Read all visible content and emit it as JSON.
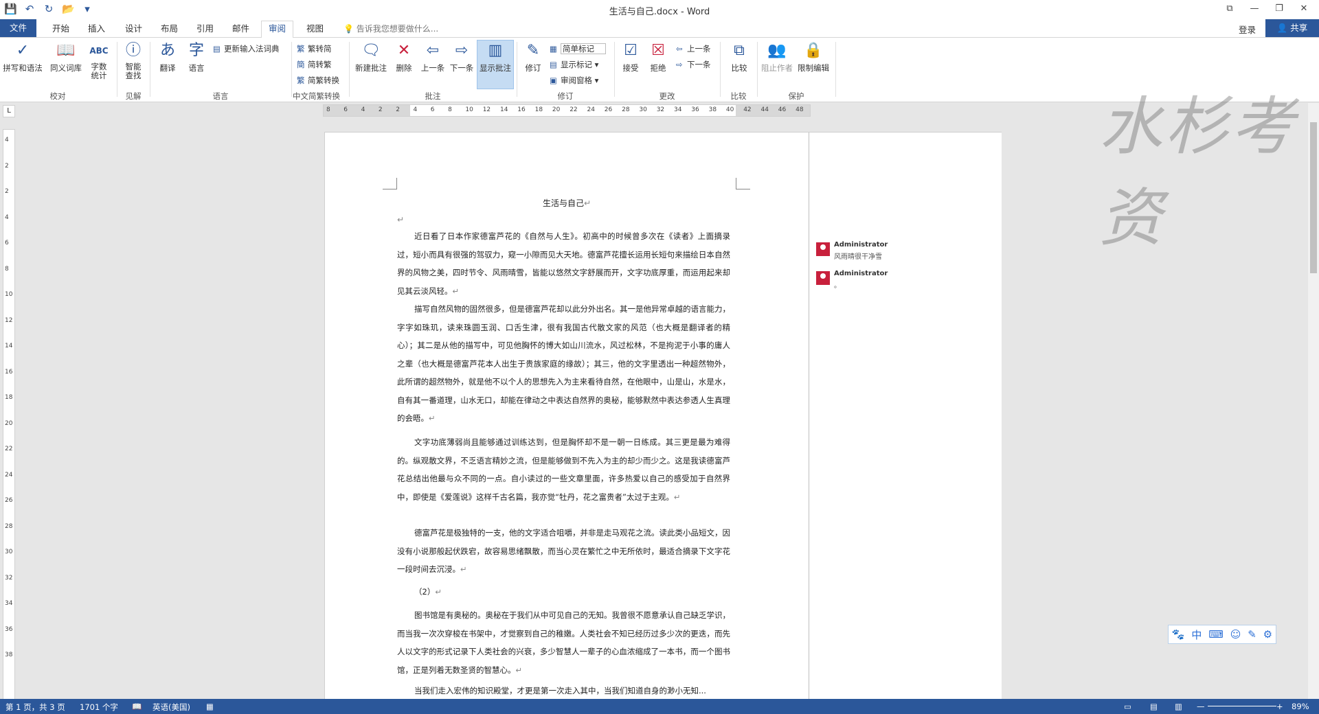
{
  "window": {
    "title": "生活与自己.docx - Word"
  },
  "qat": {
    "save_icon": "💾",
    "undo_icon": "↶",
    "redo_icon": "↻",
    "open_icon": "📂",
    "more_icon": "▾"
  },
  "tabs": {
    "file": "文件",
    "items": [
      "开始",
      "插入",
      "设计",
      "布局",
      "引用",
      "邮件",
      "审阅",
      "视图"
    ],
    "tell_me": "告诉我您想要做什么...",
    "login": "登录",
    "share": "共享"
  },
  "ribbon": {
    "spell": "拼写和语法",
    "thesaurus": "同义词库",
    "wordcount": "字数\n统计",
    "smart": "智能\n查找",
    "translate": "翻译",
    "language": "语言",
    "update_ime": "更新输入法词典",
    "t2s": "繁转简",
    "s2t": "简转繁",
    "convert": "简繁转换",
    "new_comment": "新建批注",
    "delete": "删除",
    "prev": "上一条",
    "next": "下一条",
    "show_comments": "显示批注",
    "track": "修订",
    "simple_markup": "简单标记",
    "show_markup": "显示标记",
    "review_pane": "审阅窗格",
    "accept": "接受",
    "reject": "拒绝",
    "prev2": "上一条",
    "next2": "下一条",
    "compare": "比较",
    "block_authors": "阻止作者",
    "restrict": "限制编辑",
    "groups": {
      "proofing": "校对",
      "insights": "见解",
      "language": "语言",
      "chinese": "中文简繁转换",
      "comments": "批注",
      "tracking": "修订",
      "changes": "更改",
      "compare": "比较",
      "protect": "保护"
    }
  },
  "ruler": {
    "h": [
      "8",
      "6",
      "4",
      "2",
      "2",
      "4",
      "6",
      "8",
      "10",
      "12",
      "14",
      "16",
      "18",
      "20",
      "22",
      "24",
      "26",
      "28",
      "30",
      "32",
      "34",
      "36",
      "38",
      "40",
      "42",
      "44",
      "46",
      "48"
    ],
    "v": [
      "4",
      "2",
      "2",
      "4",
      "6",
      "8",
      "10",
      "12",
      "14",
      "16",
      "18",
      "20",
      "22",
      "24",
      "26",
      "28",
      "30",
      "32",
      "34",
      "36",
      "38"
    ]
  },
  "document": {
    "title": "生活与自己",
    "paras": [
      "近日看了日本作家德富芦花的《自然与人生》。初高中的时候曾多次在《读者》上面摘录过，短小而具有很强的驾驭力，窥一小隙而见大天地。德富芦花擅长运用长短句来描绘日本自然界的风物之美，四时节令、风雨晴雪，皆能以悠然文字舒展而开，文字功底厚重，而运用起来却见其云淡风轻。",
      "描写自然风物的固然很多，但是德富芦花却以此分外出名。其一是他异常卓越的语言能力，字字如珠玑，读来珠圆玉润、口舌生津，很有我国古代散文家的风范（也大概是翻译者的精心）；其二是从他的描写中，可见他胸怀的博大如山川流水，风过松林，不是拘泥于小事的庸人之辈（也大概是德富芦花本人出生于贵族家庭的缘故）；其三，他的文字里透出一种超然物外，此所谓的超然物外，就是他不以个人的思想先入为主来看待自然，在他眼中，山是山，水是水，自有其一番道理，山水无口，却能在律动之中表达自然界的奥秘，能够默然中表达参透人生真理的会晤。",
      "文字功底薄弱尚且能够通过训练达到，但是胸怀却不是一朝一日练成。其三更是最为难得的。纵观散文界，不乏语言精妙之流，但是能够做到不先入为主的却少而少之。这是我读德富芦花总结出他最与众不同的一点。自小读过的一些文章里面，许多热爱以自己的感受加于自然界中，即使是《爱莲说》这样千古名篇，我亦觉“牡丹，花之富贵者”太过于主观。",
      "德富芦花是极独特的一支，他的文字适合咀嚼，并非是走马观花之流。读此类小品短文，因没有小说那般起伏跌宕，故容易思绪飘散，而当心灵在繁忙之中无所依时，最适合摘录下文字花一段时间去沉浸。",
      "（2）",
      "图书馆是有奥秘的。奥秘在于我们从中可见自己的无知。我曾很不愿意承认自己缺乏学识，而当我一次次穿梭在书架中，才觉察到自己的稚嫩。人类社会不知已经历过多少次的更迭，而先人以文字的形式记录下人类社会的兴衰，多少智慧人一辈子的心血浓缩成了一本书，而一个图书馆，正是列着无数圣贤的智慧心。",
      "当我们走入宏伟的知识殿堂，才更是第一次走入其中，当我们知道自身的渺小无知..."
    ],
    "para_mark": "↵"
  },
  "comments": [
    {
      "author": "Administrator",
      "text": "风雨晴很干净雪"
    },
    {
      "author": "Administrator",
      "text": "。"
    }
  ],
  "watermark": "水杉考资",
  "ime": [
    "🐾",
    "中",
    "⌨",
    "☺",
    "✎",
    "⚙"
  ],
  "status": {
    "page": "第 1 页，共 3 页",
    "words": "1701 个字",
    "lang": "英语(美国)",
    "zoom": "89%"
  }
}
